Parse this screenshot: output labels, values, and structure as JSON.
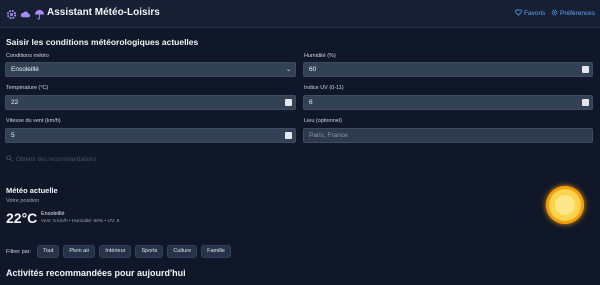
{
  "header": {
    "title": "Assistant Météo-Loisirs",
    "icons": [
      "gear-icon",
      "cloud-icon",
      "umbrella-icon"
    ],
    "nav": {
      "favorites": "Favoris",
      "preferences": "Préférences"
    }
  },
  "form": {
    "title": "Saisir les conditions météorologiques actuelles",
    "conditions": {
      "label": "Conditions météo",
      "value": "Ensoleillé"
    },
    "humidity": {
      "label": "Humidité (%)",
      "value": "60"
    },
    "temperature": {
      "label": "Température (°C)",
      "value": "22"
    },
    "uv": {
      "label": "Indice UV (0-11)",
      "value": "6"
    },
    "wind": {
      "label": "Vitesse du vent (km/h)",
      "value": "5"
    },
    "location": {
      "label": "Lieu (optionnel)",
      "placeholder": "Paris, France"
    },
    "submit_label": "Obtenir des recommandations"
  },
  "weather": {
    "title": "Météo actuelle",
    "position": "Votre position",
    "temperature": "22°C",
    "condition": "Ensoleillé",
    "details": "Vent: 5 km/h • Humidité: 60% • UV: 6"
  },
  "filters": {
    "label": "Filtrer par:",
    "items": [
      "Tout",
      "Plein air",
      "Intérieur",
      "Sports",
      "Culture",
      "Famille"
    ]
  },
  "activities": {
    "title": "Activités recommandées pour aujourd'hui"
  },
  "colors": {
    "background": "#0f1729",
    "field": "#334155",
    "accent": "#60a5fa",
    "sun": "#fcd34d"
  }
}
